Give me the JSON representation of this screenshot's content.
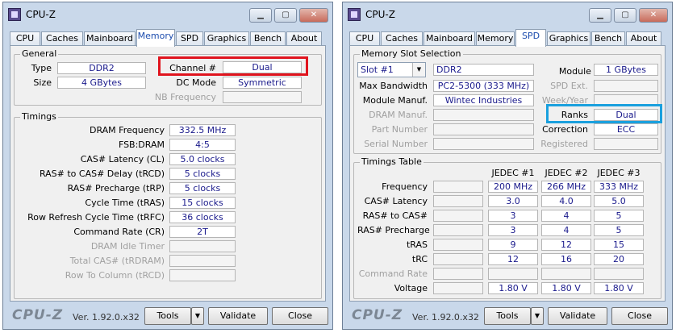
{
  "app_title": "CPU-Z",
  "tabs": [
    "CPU",
    "Caches",
    "Mainboard",
    "Memory",
    "SPD",
    "Graphics",
    "Bench",
    "About"
  ],
  "memory": {
    "general_title": "General",
    "type_label": "Type",
    "type_value": "DDR2",
    "size_label": "Size",
    "size_value": "4 GBytes",
    "channel_label": "Channel #",
    "channel_value": "Dual",
    "dc_mode_label": "DC Mode",
    "dc_mode_value": "Symmetric",
    "nb_freq_label": "NB Frequency",
    "nb_freq_value": "",
    "timings_title": "Timings",
    "timings": [
      {
        "label": "DRAM Frequency",
        "value": "332.5 MHz",
        "enabled": true
      },
      {
        "label": "FSB:DRAM",
        "value": "4:5",
        "enabled": true
      },
      {
        "label": "CAS# Latency (CL)",
        "value": "5.0 clocks",
        "enabled": true
      },
      {
        "label": "RAS# to CAS# Delay (tRCD)",
        "value": "5 clocks",
        "enabled": true
      },
      {
        "label": "RAS# Precharge (tRP)",
        "value": "5 clocks",
        "enabled": true
      },
      {
        "label": "Cycle Time (tRAS)",
        "value": "15 clocks",
        "enabled": true
      },
      {
        "label": "Row Refresh Cycle Time (tRFC)",
        "value": "36 clocks",
        "enabled": true
      },
      {
        "label": "Command Rate (CR)",
        "value": "2T",
        "enabled": true
      },
      {
        "label": "DRAM Idle Timer",
        "value": "",
        "enabled": false
      },
      {
        "label": "Total CAS# (tRDRAM)",
        "value": "",
        "enabled": false
      },
      {
        "label": "Row To Column (tRCD)",
        "value": "",
        "enabled": false
      }
    ]
  },
  "spd": {
    "slot_title": "Memory Slot Selection",
    "slot_value": "Slot #1",
    "type_value": "DDR2",
    "module_size_label": "Module Size",
    "module_size_value": "1 GBytes",
    "max_bw_label": "Max Bandwidth",
    "max_bw_value": "PC2-5300 (333 MHz)",
    "spd_ext_label": "SPD Ext.",
    "spd_ext_value": "",
    "manuf_label": "Module Manuf.",
    "manuf_value": "Wintec Industries",
    "week_year_label": "Week/Year",
    "week_year_value": "",
    "dram_manuf_label": "DRAM Manuf.",
    "dram_manuf_value": "",
    "ranks_label": "Ranks",
    "ranks_value": "Dual",
    "part_number_label": "Part Number",
    "part_number_value": "",
    "correction_label": "Correction",
    "correction_value": "ECC",
    "serial_label": "Serial Number",
    "serial_value": "",
    "registered_label": "Registered",
    "registered_value": "",
    "timings_table_title": "Timings Table",
    "jedec_headers": [
      "JEDEC #1",
      "JEDEC #2",
      "JEDEC #3"
    ],
    "table_rows": [
      {
        "label": "Frequency",
        "values": [
          "200 MHz",
          "266 MHz",
          "333 MHz"
        ],
        "enabled": true
      },
      {
        "label": "CAS# Latency",
        "values": [
          "3.0",
          "4.0",
          "5.0"
        ],
        "enabled": true
      },
      {
        "label": "RAS# to CAS#",
        "values": [
          "3",
          "4",
          "5"
        ],
        "enabled": true
      },
      {
        "label": "RAS# Precharge",
        "values": [
          "3",
          "4",
          "5"
        ],
        "enabled": true
      },
      {
        "label": "tRAS",
        "values": [
          "9",
          "12",
          "15"
        ],
        "enabled": true
      },
      {
        "label": "tRC",
        "values": [
          "12",
          "16",
          "20"
        ],
        "enabled": true
      },
      {
        "label": "Command Rate",
        "values": [
          "",
          "",
          ""
        ],
        "enabled": false
      },
      {
        "label": "Voltage",
        "values": [
          "1.80 V",
          "1.80 V",
          "1.80 V"
        ],
        "enabled": true
      }
    ]
  },
  "footer": {
    "logo": "CPU-Z",
    "version": "Ver. 1.92.0.x32",
    "tools_label": "Tools",
    "validate_label": "Validate",
    "close_label": "Close"
  }
}
